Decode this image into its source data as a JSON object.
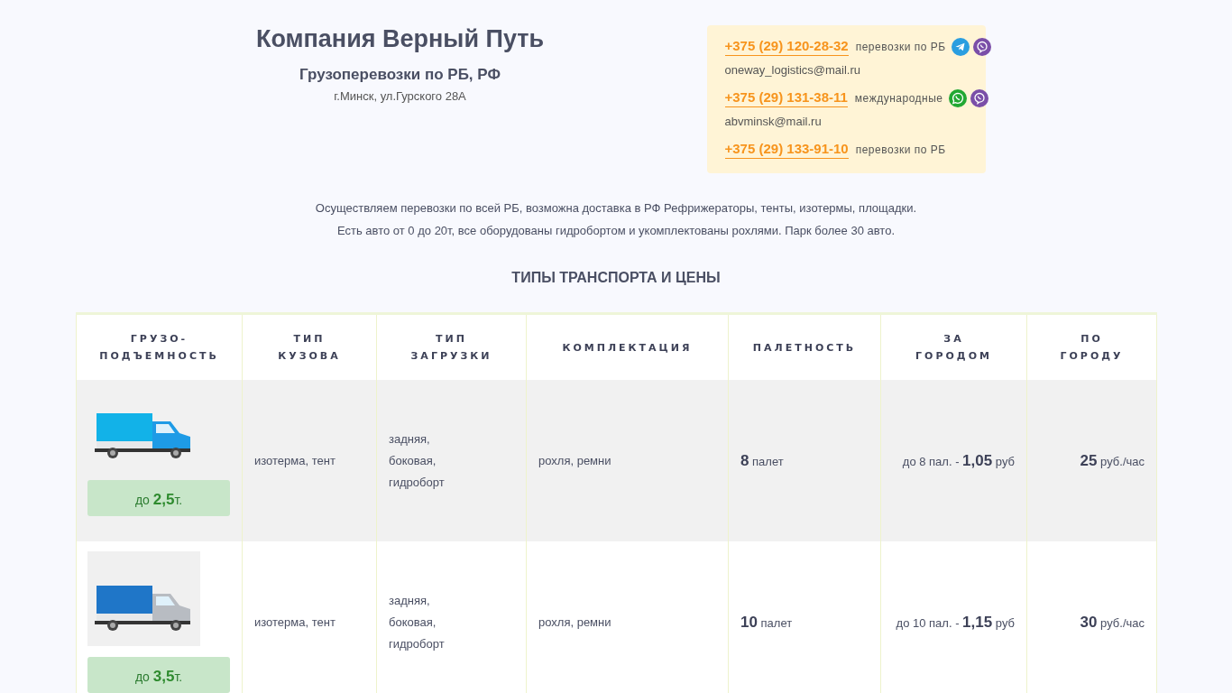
{
  "company": {
    "name": "Компания Верный Путь",
    "subtitle": "Грузоперевозки по РБ, РФ",
    "address": "г.Минск, ул.Гурского 28А"
  },
  "contacts": [
    {
      "phone": "+375 (29) 120-28-32",
      "note": "перевозки по РБ",
      "messengers": [
        {
          "kind": "telegram"
        },
        {
          "kind": "viber"
        }
      ],
      "email": "oneway_logistics@mail.ru"
    },
    {
      "phone": "+375 (29) 131-38-11",
      "note": "международные",
      "messengers": [
        {
          "kind": "whatsapp"
        },
        {
          "kind": "viber"
        }
      ],
      "email": "abvminsk@mail.ru"
    },
    {
      "phone": "+375 (29) 133-91-10",
      "note": "перевозки по РБ"
    }
  ],
  "intro": [
    "Осуществляем перевозки по всей РБ, возможна доставка в РФ Рефрижераторы, тенты, изотермы, площадки.",
    "Есть авто от 0 до 20т, все оборудованы гидробортом и укомплектованы рохлями. Парк более 30 авто."
  ],
  "section_title": "ТИПЫ ТРАНСПОРТА И ЦЕНЫ",
  "table": {
    "columns": [
      "ГРУЗО-ПОДЪЕМНОСТЬ",
      "ТИП КУЗОВА",
      "ТИП ЗАГРУЗКИ",
      "КОМПЛЕКТАЦИЯ",
      "ПАЛЕТНОСТЬ",
      "ЗА ГОРОДОМ",
      "ПО ГОРОДУ"
    ],
    "rows": [
      {
        "truck": {
          "kind": "blue"
        },
        "capacity": "до **2,5**т.",
        "body": "изотерма, тент",
        "loading": "задняя, боковая, гидроборт",
        "equipment": "рохля, ремни",
        "pallets": "**8** палет",
        "intercity": "до 8 пал. - **1,05** руб",
        "city": "**25** руб./час"
      },
      {
        "truck": {
          "kind": "grey"
        },
        "capacity": "до **3,5**т.",
        "body": "изотерма, тент",
        "loading": "задняя, боковая, гидроборт",
        "equipment": "рохля, ремни",
        "pallets": "**10** палет",
        "intercity": "до 10 пал. - **1,15** руб",
        "city": "**30** руб./час"
      }
    ]
  }
}
